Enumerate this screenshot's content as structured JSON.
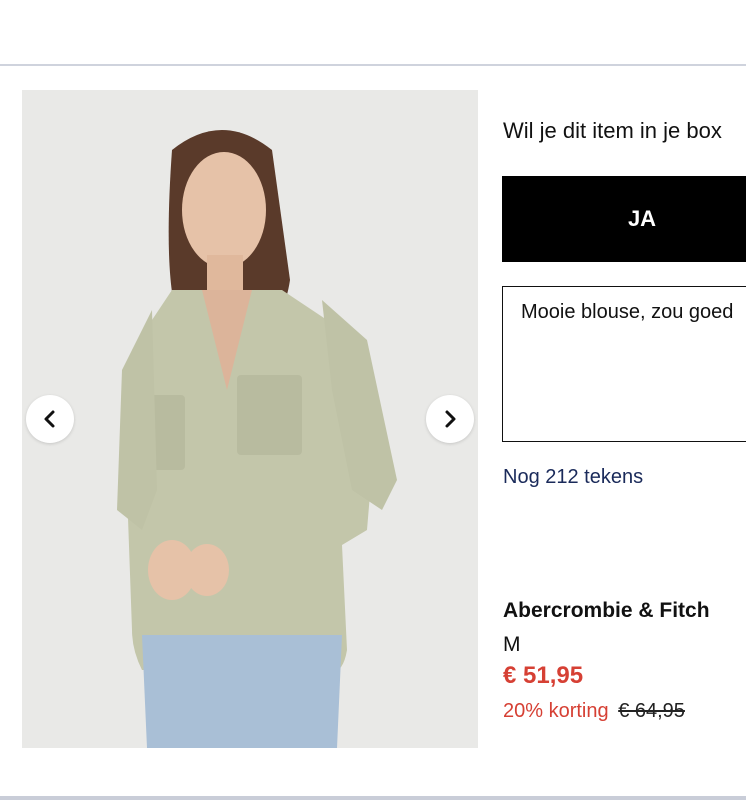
{
  "colors": {
    "accent_red": "#d64034",
    "link_navy": "#1a2a5a",
    "button_bg": "#000000"
  },
  "box": {
    "question": "Wil je dit item in je box",
    "yes_label": "JA",
    "comment_value": "Mooie blouse, zou goed",
    "chars_left": "Nog 212 tekens"
  },
  "product": {
    "brand": "Abercrombie & Fitch",
    "size": "M",
    "price": "€ 51,95",
    "discount": "20% korting",
    "old_price": "€ 64,95"
  },
  "carousel": {
    "prev_icon": "chevron-left-icon",
    "next_icon": "chevron-right-icon"
  }
}
